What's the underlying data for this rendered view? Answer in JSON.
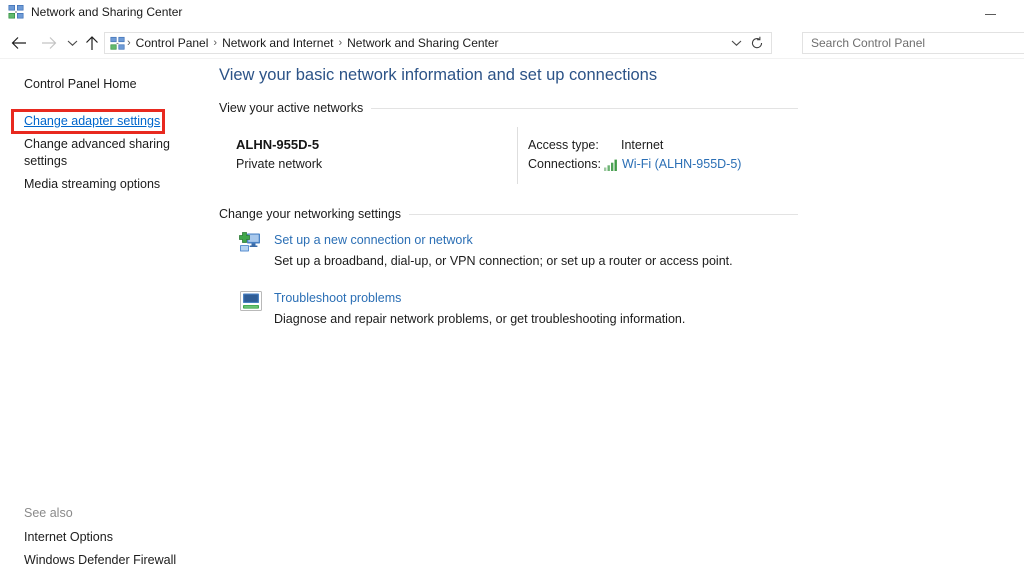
{
  "window": {
    "title": "Network and Sharing Center",
    "icon": "network-sharing-icon",
    "minimize_label": "Minimize"
  },
  "navbar": {
    "back_icon": "arrow-left-icon",
    "forward_icon": "arrow-right-icon",
    "recent_icon": "chevron-down-icon",
    "up_icon": "arrow-up-icon",
    "address_icon": "network-sharing-icon",
    "breadcrumbs": [
      "Control Panel",
      "Network and Internet",
      "Network and Sharing Center"
    ],
    "separator": "›",
    "dropdown_icon": "chevron-down-icon",
    "refresh_icon": "refresh-icon"
  },
  "search": {
    "placeholder": "Search Control Panel",
    "value": ""
  },
  "sidebar": {
    "home_label": "Control Panel Home",
    "items": [
      {
        "label": "Change adapter settings",
        "highlighted": true
      },
      {
        "label": "Change advanced sharing settings",
        "highlighted": false
      },
      {
        "label": "Media streaming options",
        "highlighted": false
      }
    ],
    "see_also": {
      "title": "See also",
      "links": [
        "Internet Options",
        "Windows Defender Firewall"
      ]
    },
    "highlight_color": "#e8291f"
  },
  "main": {
    "heading": "View your basic network information and set up connections",
    "sections": [
      {
        "title": "View your active networks"
      },
      {
        "title": "Change your networking settings"
      }
    ],
    "active_network": {
      "name": "ALHN-955D-5",
      "type": "Private network",
      "access_type_label": "Access type:",
      "access_type_value": "Internet",
      "connections_label": "Connections:",
      "connections_value": "Wi-Fi (ALHN-955D-5)",
      "signal_icon": "wifi-signal-bars-icon"
    },
    "tasks": [
      {
        "icon": "new-connection-icon",
        "link": "Set up a new connection or network",
        "description": "Set up a broadband, dial-up, or VPN connection; or set up a router or access point."
      },
      {
        "icon": "troubleshoot-icon",
        "link": "Troubleshoot problems",
        "description": "Diagnose and repair network problems, or get troubleshooting information."
      }
    ]
  },
  "colors": {
    "heading_blue": "#2c5387",
    "link_blue": "#2b6fb5",
    "hover_link_blue": "#0066cc",
    "signal_green": "#3f9b46"
  }
}
